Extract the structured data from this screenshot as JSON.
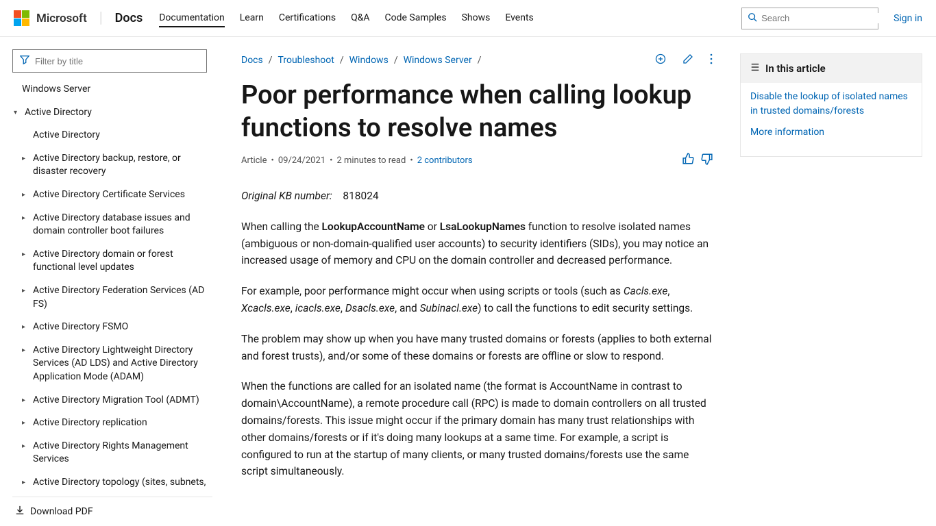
{
  "header": {
    "brand": "Microsoft",
    "product": "Docs",
    "nav": [
      "Documentation",
      "Learn",
      "Certifications",
      "Q&A",
      "Code Samples",
      "Shows",
      "Events"
    ],
    "search_placeholder": "Search",
    "signin": "Sign in"
  },
  "sidebar": {
    "filter_placeholder": "Filter by title",
    "root": "Windows Server",
    "section": "Active Directory",
    "items": [
      "Active Directory",
      "Active Directory backup, restore, or disaster recovery",
      "Active Directory Certificate Services",
      "Active Directory database issues and domain controller boot failures",
      "Active Directory domain or forest functional level updates",
      "Active Directory Federation Services (AD FS)",
      "Active Directory FSMO",
      "Active Directory Lightweight Directory Services (AD LDS) and Active Directory Application Mode (ADAM)",
      "Active Directory Migration Tool (ADMT)",
      "Active Directory replication",
      "Active Directory Rights Management Services",
      "Active Directory topology (sites, subnets,"
    ],
    "download": "Download PDF"
  },
  "breadcrumb": [
    "Docs",
    "Troubleshoot",
    "Windows",
    "Windows Server"
  ],
  "article": {
    "title": "Poor performance when calling lookup functions to resolve names",
    "meta_type": "Article",
    "meta_date": "09/24/2021",
    "meta_read": "2 minutes to read",
    "contributors": "2 contributors",
    "kb_label": "Original KB number:",
    "kb_number": "818024",
    "p1_a": "When calling the ",
    "p1_b": "LookupAccountName",
    "p1_c": " or ",
    "p1_d": "LsaLookupNames",
    "p1_e": " function to resolve isolated names (ambiguous or non-domain-qualified user accounts) to security identifiers (SIDs), you may notice an increased usage of memory and CPU on the domain controller and decreased performance.",
    "p2_a": "For example, poor performance might occur when using scripts or tools (such as ",
    "p2_t1": "Cacls.exe",
    "p2_s1": ", ",
    "p2_t2": "Xcacls.exe",
    "p2_s2": ", ",
    "p2_t3": "icacls.exe",
    "p2_s3": ", ",
    "p2_t4": "Dsacls.exe",
    "p2_s4": ", and ",
    "p2_t5": "Subinacl.exe",
    "p2_b": ") to call the functions to edit security settings.",
    "p3": "The problem may show up when you have many trusted domains or forests (applies to both external and forest trusts), and/or some of these domains or forests are offline or slow to respond.",
    "p4": "When the functions are called for an isolated name (the format is AccountName in contrast to domain\\AccountName), a remote procedure call (RPC) is made to domain controllers on all trusted domains/forests. This issue might occur if the primary domain has many trust relationships with other domains/forests or if it's doing many lookups at a same time. For example, a script is configured to run at the startup of many clients, or many trusted domains/forests use the same script simultaneously."
  },
  "toc": {
    "heading": "In this article",
    "links": [
      "Disable the lookup of isolated names in trusted domains/forests",
      "More information"
    ]
  }
}
